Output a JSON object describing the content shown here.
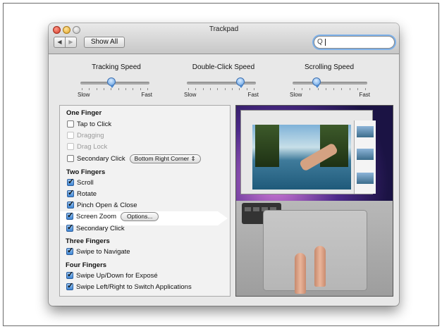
{
  "window": {
    "title": "Trackpad"
  },
  "toolbar": {
    "back_glyph": "◀",
    "forward_glyph": "▶",
    "show_all_label": "Show All",
    "search_icon": "Q"
  },
  "sliders": [
    {
      "label": "Tracking Speed",
      "min_label": "Slow",
      "max_label": "Fast",
      "value": 0.45
    },
    {
      "label": "Double-Click Speed",
      "min_label": "Slow",
      "max_label": "Fast",
      "value": 0.78
    },
    {
      "label": "Scrolling Speed",
      "min_label": "Slow",
      "max_label": "Fast",
      "value": 0.32
    }
  ],
  "sections": {
    "one_finger": "One Finger",
    "two_fingers": "Two Fingers",
    "three_fingers": "Three Fingers",
    "four_fingers": "Four Fingers"
  },
  "options": {
    "tap_to_click": "Tap to Click",
    "dragging": "Dragging",
    "drag_lock": "Drag Lock",
    "secondary_click_one": "Secondary Click",
    "secondary_click_popup": "Bottom Right Corner",
    "scroll": "Scroll",
    "rotate": "Rotate",
    "pinch": "Pinch Open & Close",
    "screen_zoom": "Screen Zoom",
    "options_button": "Options...",
    "secondary_click_two": "Secondary Click",
    "swipe_navigate": "Swipe to Navigate",
    "swipe_expose": "Swipe Up/Down for Exposé",
    "swipe_switch": "Swipe Left/Right to Switch Applications"
  },
  "popup_arrows": "⇕"
}
